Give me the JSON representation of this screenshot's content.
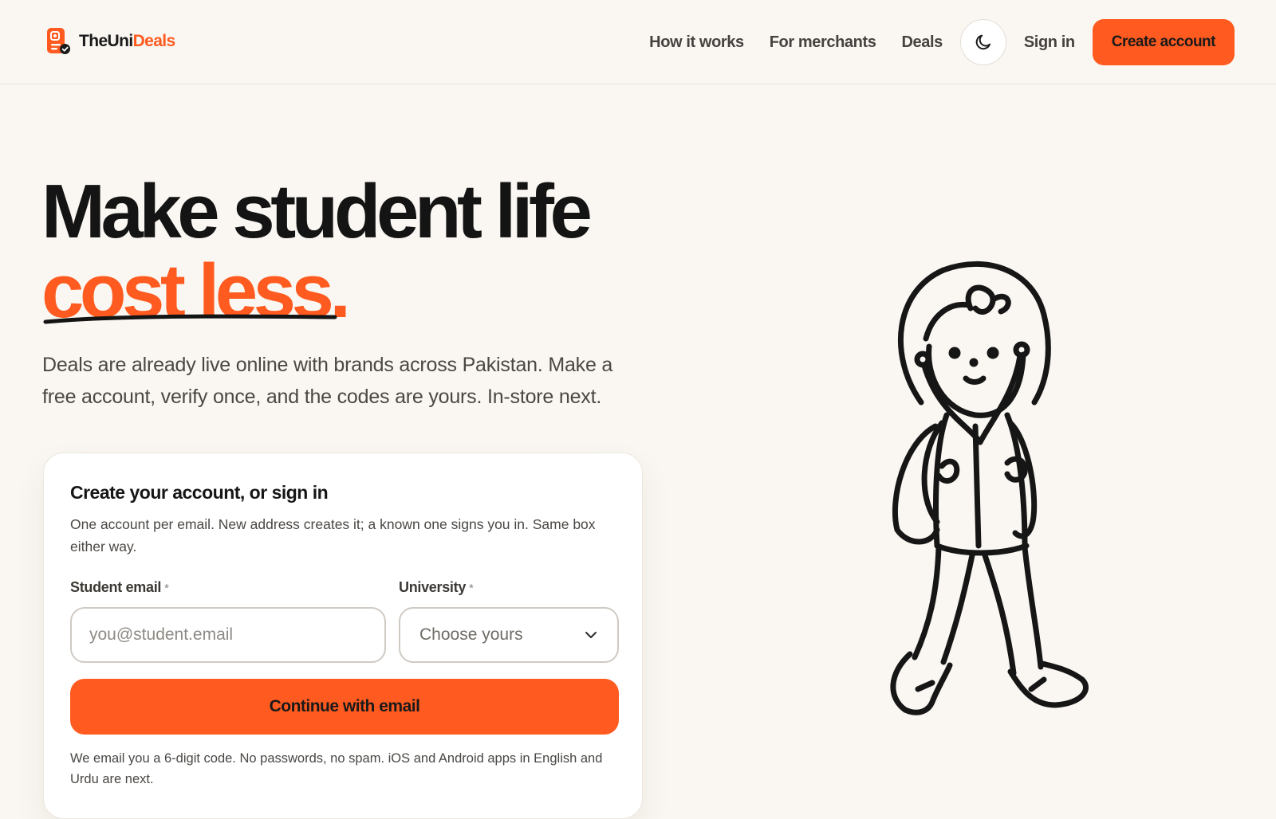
{
  "brand": {
    "prefix": "The",
    "middle": "Uni",
    "suffix": "Deals",
    "accent": "#ff5a1f"
  },
  "nav": {
    "how_it_works": "How it works",
    "for_merchants": "For merchants",
    "deals": "Deals",
    "theme_toggle_icon": "moon-icon",
    "sign_in": "Sign in",
    "create_account": "Create account"
  },
  "hero": {
    "title_line1": "Make student life",
    "title_line2": "cost less.",
    "subtitle": "Deals are already live online with brands across Pakistan. Make a free account, verify once, and the codes are yours. In-store next."
  },
  "form": {
    "title": "Create your account, or sign in",
    "description": "One account per email. New address creates it; a known one signs you in. Same box either way.",
    "email_label": "Student email",
    "email_placeholder": "you@student.email",
    "university_label": "University",
    "required_mark": "*",
    "university_value": "Choose yours",
    "submit_label": "Continue with email",
    "note": "We email you a 6-digit code. No passwords, no spam. iOS and Android apps in English and Urdu are next."
  },
  "illustration": {
    "icon": "student-walking-illustration"
  }
}
